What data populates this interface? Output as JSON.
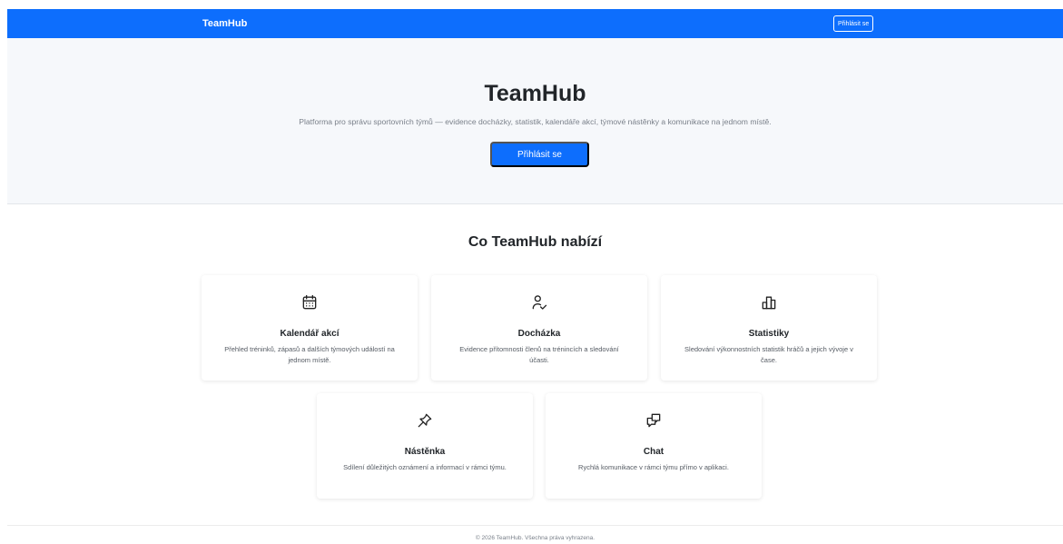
{
  "navbar": {
    "brand": "TeamHub",
    "login_label": "Přihlásit se"
  },
  "hero": {
    "title": "TeamHub",
    "subtitle": "Platforma pro správu sportovních týmů — evidence docházky, statistik, kalendáře akcí, týmové nástěnky a komunikace na jednom místě.",
    "button_label": "Přihlásit se"
  },
  "features": {
    "title": "Co TeamHub nabízí",
    "cards": [
      {
        "icon": "calendar-icon",
        "title": "Kalendář akcí",
        "description": "Přehled tréninků, zápasů a dalších týmových událostí na jednom místě."
      },
      {
        "icon": "user-check-icon",
        "title": "Docházka",
        "description": "Evidence přítomnosti členů na trénincích a sledování účasti."
      },
      {
        "icon": "bar-chart-icon",
        "title": "Statistiky",
        "description": "Sledování výkonnostních statistik hráčů a jejich vývoje v čase."
      },
      {
        "icon": "pin-icon",
        "title": "Nástěnka",
        "description": "Sdílení důležitých oznámení a informací v rámci týmu."
      },
      {
        "icon": "chat-icon",
        "title": "Chat",
        "description": "Rychlá komunikace v rámci týmu přímo v aplikaci."
      }
    ]
  },
  "footer": {
    "text": "© 2026 TeamHub. Všechna práva vyhrazena."
  },
  "colors": {
    "primary": "#0d6efd",
    "hero_bg": "#f6f8fb",
    "text": "#212529",
    "muted": "#7a808a"
  }
}
